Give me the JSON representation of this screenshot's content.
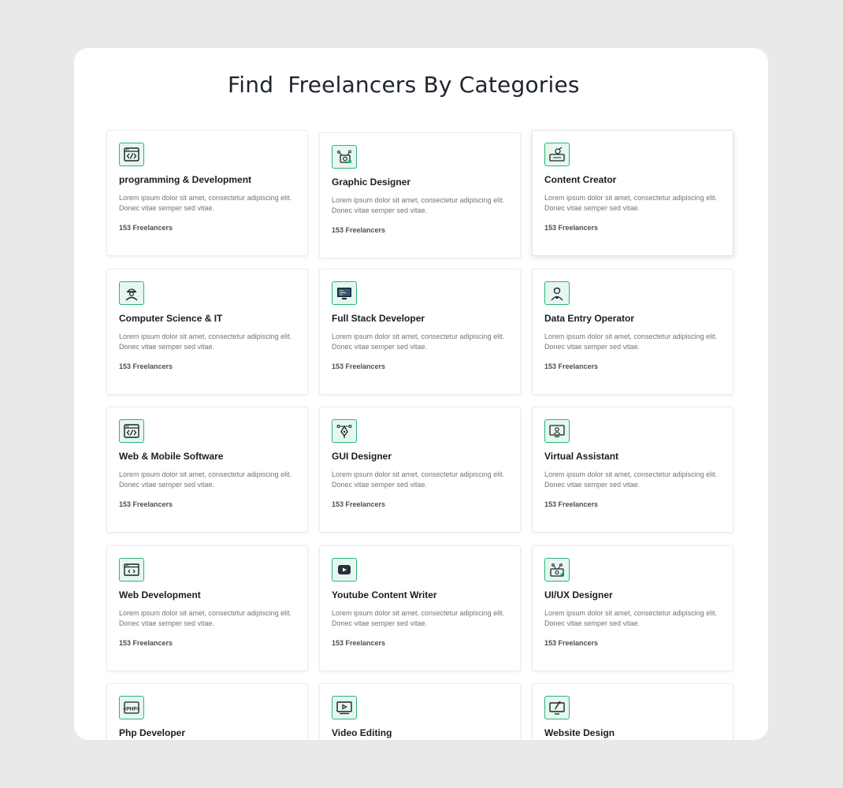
{
  "title": "Find  Freelancers By Categories",
  "description": "Lorem ipsum dolor sit amet, consectetur adipiscing elit. Donec vitae semper sed vitae.",
  "count_label": "153 Freelancers",
  "colors": {
    "accent": "#2bb673",
    "accent_bg": "#e6f7ef",
    "page_bg": "#e9e9ea",
    "panel_bg": "#ffffff"
  },
  "cards": [
    {
      "title": "programming & Development",
      "icon": "code-window-icon"
    },
    {
      "title": "Graphic Designer",
      "icon": "graphic-design-icon"
    },
    {
      "title": "Content Creator",
      "icon": "content-creator-icon"
    },
    {
      "title": "Computer Science & IT",
      "icon": "engineer-icon"
    },
    {
      "title": "Full Stack Developer",
      "icon": "monitor-code-icon"
    },
    {
      "title": "Data Entry Operator",
      "icon": "operator-person-icon"
    },
    {
      "title": "Web & Mobile Software",
      "icon": "code-window-icon"
    },
    {
      "title": "GUI Designer",
      "icon": "pen-tool-icon"
    },
    {
      "title": "Virtual Assistant",
      "icon": "virtual-assistant-icon"
    },
    {
      "title": "Web Development",
      "icon": "browser-code-icon"
    },
    {
      "title": "Youtube Content Writer",
      "icon": "youtube-play-icon"
    },
    {
      "title": "UI/UX Designer",
      "icon": "ui-ux-design-icon"
    },
    {
      "title": "Php Developer",
      "icon": "php-icon"
    },
    {
      "title": "Video Editing",
      "icon": "video-player-icon"
    },
    {
      "title": "Website Design",
      "icon": "website-design-icon"
    }
  ]
}
